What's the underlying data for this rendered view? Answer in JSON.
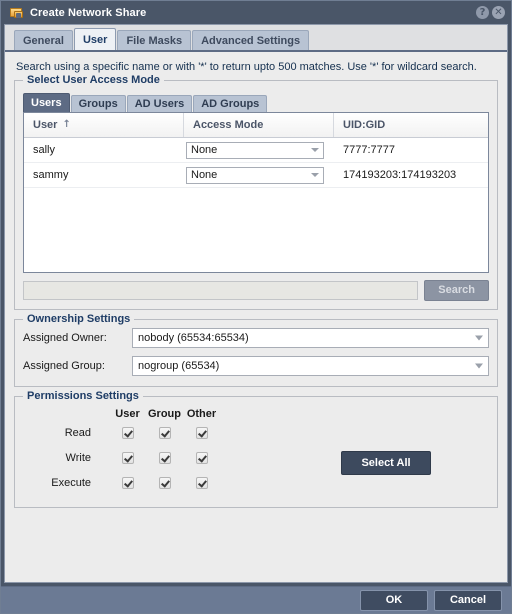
{
  "window": {
    "title": "Create Network Share",
    "icon": "network-share-icon",
    "help_label": "?",
    "close_label": "✕"
  },
  "tabs": [
    {
      "label": "General",
      "active": false
    },
    {
      "label": "User",
      "active": true
    },
    {
      "label": "File Masks",
      "active": false
    },
    {
      "label": "Advanced Settings",
      "active": false
    }
  ],
  "hint": "Search using a specific name or with '*' to return upto 500 matches. Use '*' for wildcard search.",
  "access_mode_section": {
    "legend": "Select User Access Mode",
    "subtabs": [
      {
        "label": "Users",
        "active": true
      },
      {
        "label": "Groups",
        "active": false
      },
      {
        "label": "AD Users",
        "active": false
      },
      {
        "label": "AD Groups",
        "active": false
      }
    ],
    "table": {
      "columns": [
        "User",
        "Access Mode",
        "UID:GID"
      ],
      "sort_column": "User",
      "sort_indicator": "↑",
      "rows": [
        {
          "user": "sally",
          "access_mode": "None",
          "uid_gid": "7777:7777"
        },
        {
          "user": "sammy",
          "access_mode": "None",
          "uid_gid": "174193203:174193203"
        }
      ]
    },
    "search_value": "",
    "search_placeholder": "",
    "search_button": "Search"
  },
  "ownership": {
    "legend": "Ownership Settings",
    "owner_label": "Assigned Owner:",
    "owner_value": "nobody (65534:65534)",
    "group_label": "Assigned Group:",
    "group_value": "nogroup (65534)"
  },
  "permissions": {
    "legend": "Permissions Settings",
    "columns": [
      "User",
      "Group",
      "Other"
    ],
    "rows": [
      {
        "label": "Read",
        "user": true,
        "group": true,
        "other": true
      },
      {
        "label": "Write",
        "user": true,
        "group": true,
        "other": true
      },
      {
        "label": "Execute",
        "user": true,
        "group": true,
        "other": true
      }
    ],
    "select_all_label": "Select All"
  },
  "footer": {
    "ok_label": "OK",
    "cancel_label": "Cancel"
  },
  "colors": {
    "titlebar": "#4a5668",
    "footer": "#6b7a94",
    "accent_text": "#1f3d66",
    "active_subtab": "#5d6b84",
    "button_dark": "#3d4a5e"
  }
}
